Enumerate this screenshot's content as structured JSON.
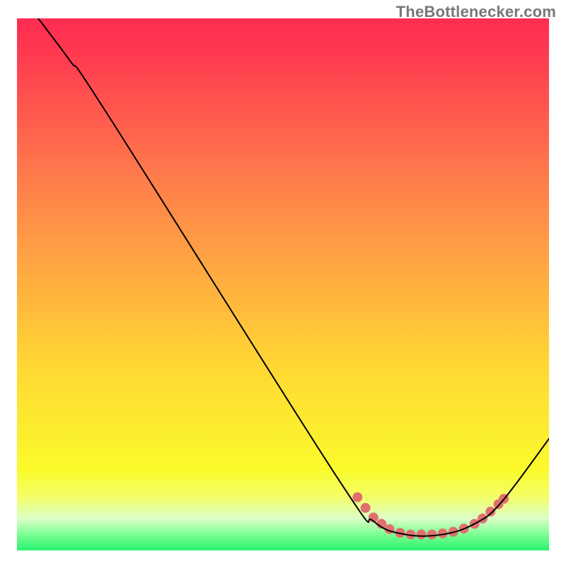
{
  "attribution": "TheBottlenecker.com",
  "chart_data": {
    "type": "line",
    "title": "",
    "xlabel": "",
    "ylabel": "",
    "xlim": [
      0,
      100
    ],
    "ylim": [
      0,
      100
    ],
    "grid": false,
    "line_color": "#000000",
    "marker_color": "#e07070",
    "curve": [
      {
        "x": 4,
        "y": 100
      },
      {
        "x": 10,
        "y": 92
      },
      {
        "x": 17,
        "y": 82
      },
      {
        "x": 60,
        "y": 14
      },
      {
        "x": 67,
        "y": 5.5
      },
      {
        "x": 73,
        "y": 3
      },
      {
        "x": 80,
        "y": 3
      },
      {
        "x": 86,
        "y": 5
      },
      {
        "x": 91,
        "y": 9
      },
      {
        "x": 100,
        "y": 21
      }
    ],
    "markers": [
      {
        "x": 64,
        "y": 10
      },
      {
        "x": 65.5,
        "y": 8
      },
      {
        "x": 67,
        "y": 6.2
      },
      {
        "x": 68.5,
        "y": 5
      },
      {
        "x": 70,
        "y": 4
      },
      {
        "x": 72,
        "y": 3.3
      },
      {
        "x": 74,
        "y": 3
      },
      {
        "x": 76,
        "y": 3
      },
      {
        "x": 78,
        "y": 3
      },
      {
        "x": 80,
        "y": 3.2
      },
      {
        "x": 82,
        "y": 3.5
      },
      {
        "x": 84,
        "y": 4.1
      },
      {
        "x": 86,
        "y": 5
      },
      {
        "x": 87.5,
        "y": 6
      },
      {
        "x": 89,
        "y": 7.3
      },
      {
        "x": 90.5,
        "y": 8.7
      },
      {
        "x": 91.5,
        "y": 9.7
      }
    ]
  }
}
